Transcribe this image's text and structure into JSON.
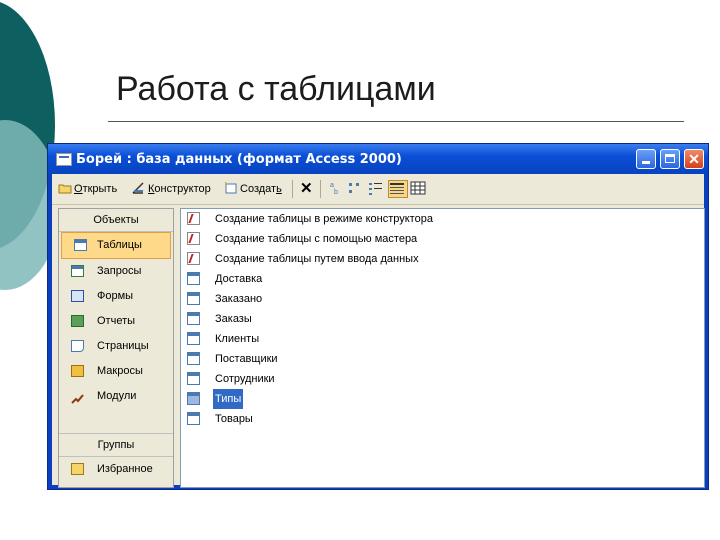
{
  "slide": {
    "title": "Работа с таблицами"
  },
  "window": {
    "title": "Борей : база данных (формат Access 2000)",
    "accent": "#0a4fd6"
  },
  "toolbar": {
    "open_label": "Открыть",
    "open_key": "О",
    "design_label": "Конструктор",
    "design_key": "К",
    "create_label": "Создать",
    "create_key": "ь"
  },
  "nav": {
    "objects_header": "Объекты",
    "items": [
      {
        "label": "Таблицы",
        "icon": "table-icon"
      },
      {
        "label": "Запросы",
        "icon": "query-icon"
      },
      {
        "label": "Формы",
        "icon": "form-icon"
      },
      {
        "label": "Отчеты",
        "icon": "report-icon"
      },
      {
        "label": "Страницы",
        "icon": "page-icon"
      },
      {
        "label": "Макросы",
        "icon": "macro-icon"
      },
      {
        "label": "Модули",
        "icon": "module-icon"
      }
    ],
    "groups_header": "Группы",
    "favorites_label": "Избранное"
  },
  "list": {
    "items": [
      "Создание таблицы в режиме конструктора",
      "Создание таблицы с помощью мастера",
      "Создание таблицы путем ввода данных",
      "Доставка",
      "Заказано",
      "Заказы",
      "Клиенты",
      "Поставщики",
      "Сотрудники",
      "Типы",
      "Товары"
    ],
    "selected": "Типы"
  }
}
